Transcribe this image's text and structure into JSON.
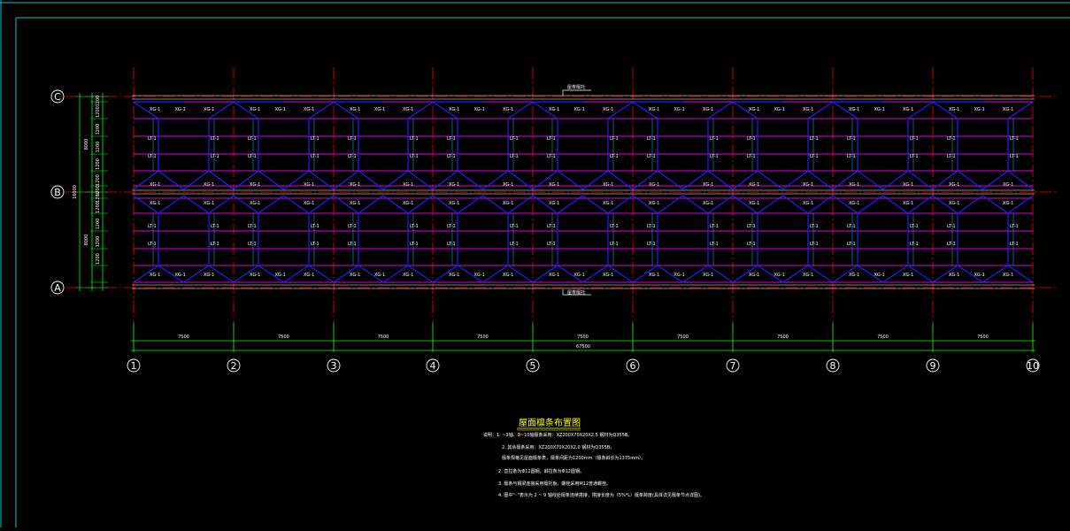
{
  "colors": {
    "background": "#000000",
    "frame": "#00c8c8",
    "axis_line": "#ff0000",
    "purlin": "#e000e0",
    "brace": "#2020ff",
    "tie": "#00c8ff",
    "dimension": "#00ff00",
    "label": "#ffffff",
    "title": "#ffff00"
  },
  "icons": {
    "row_axis_marker": "circle-icon",
    "column_axis_marker": "circle-icon"
  },
  "grid": {
    "row_axes": [
      "C",
      "B",
      "A"
    ],
    "column_axes": [
      "1",
      "2",
      "3",
      "4",
      "5",
      "6",
      "7",
      "8",
      "9",
      "10"
    ]
  },
  "dimensions": {
    "bay_labels": [
      "7500",
      "7500",
      "7500",
      "7500",
      "7500",
      "7500",
      "7500",
      "7500",
      "7500"
    ],
    "total_label": "67500",
    "left_row_labels": [
      "1200",
      "1200",
      "1200",
      "1200",
      "1200",
      "1200",
      "1200",
      "1200",
      "1200",
      "1200",
      "1200",
      "1200"
    ],
    "left_span_labels": [
      "8000",
      "8000"
    ],
    "left_total_label": "16000"
  },
  "callouts": {
    "top": "屋脊檩托",
    "bottom": "屋脊檩托"
  },
  "member_labels": {
    "brace_tag": "XG-1",
    "tie_tag": "LT-1"
  },
  "notes": {
    "title": "屋面檩条布置图",
    "lines": [
      "说明：1. ~3轴、9~10轴檩条采用：XZ200X70X20X2.5  钢材为Q355B。",
      "2. 其余檩条采用：XZ200X70X20X2.0  钢材为Q355B。",
      "檩条规格见屋面檩条表，檩条间距为1200mm（檩条斜长为1375mm）。",
      "2. 直拉条为Φ12圆钢，斜拉条为Φ12圆钢。",
      "3. 檩条与钢梁连接采用檩托板，螺栓采用M12普通螺栓。",
      "4. 图中\"◦\"表示为 2 ~ 9 轴线处檩条连续搭接，搭接长度为（5%*L）檩条跨度(具体详见檩条节点详图)。"
    ]
  }
}
